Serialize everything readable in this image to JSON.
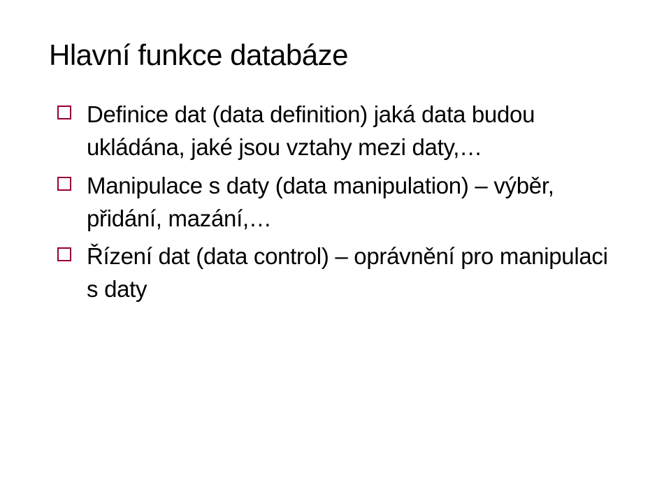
{
  "slide": {
    "title": "Hlavní funkce databáze",
    "bullets": [
      "Definice dat (data definition) jaká data budou ukládána, jaké jsou vztahy mezi daty,…",
      "Manipulace s daty (data manipulation) – výběr, přidání, mazání,…",
      "Řízení dat (data control) – oprávnění pro manipulaci s daty"
    ]
  }
}
